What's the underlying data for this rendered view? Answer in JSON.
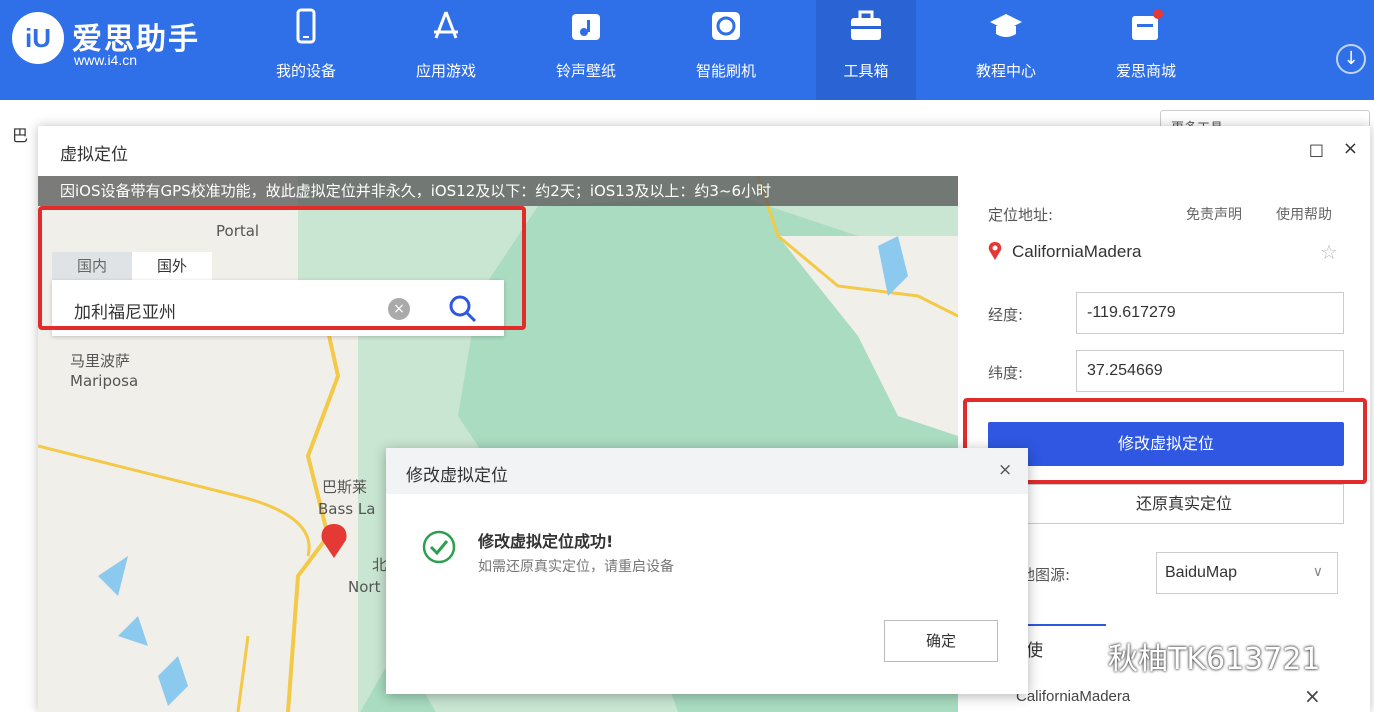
{
  "app": {
    "brand": "爱思助手",
    "url": "www.i4.cn",
    "logo_text": "iU",
    "nav": [
      {
        "label": "我的设备",
        "icon": "phone-icon"
      },
      {
        "label": "应用游戏",
        "icon": "appstore-icon"
      },
      {
        "label": "铃声壁纸",
        "icon": "music-icon"
      },
      {
        "label": "智能刷机",
        "icon": "refresh-icon"
      },
      {
        "label": "工具箱",
        "icon": "toolbox-icon"
      },
      {
        "label": "教程中心",
        "icon": "graduation-cap-icon"
      },
      {
        "label": "爱思商城",
        "icon": "shop-icon"
      }
    ],
    "active_nav": "工具箱",
    "download_icon": "download-icon"
  },
  "background": {
    "left_text": "巴",
    "right_button": "更多工具"
  },
  "window": {
    "title": "虚拟定位",
    "max_symbol": "□",
    "close_symbol": "×"
  },
  "map": {
    "notice": "因iOS设备带有GPS校准功能，故此虚拟定位并非永久，iOS12及以下：约2天；iOS13及以上：约3~6小时",
    "labels": [
      "马里波萨",
      "Mariposa",
      "巴斯莱",
      "Bass La",
      "北",
      "Nort",
      "Portal"
    ],
    "search": {
      "tab_domestic": "国内",
      "tab_foreign": "国外",
      "value": "加利福尼亚州",
      "clear_icon": "clear-icon",
      "search_icon": "search-icon"
    }
  },
  "panel": {
    "address_label": "定位地址:",
    "disclaimer_link": "免责声明",
    "help_link": "使用帮助",
    "location_name": "CaliforniaMadera",
    "longitude_label": "经度:",
    "longitude_value": "-119.617279",
    "latitude_label": "纬度:",
    "latitude_value": "37.254669",
    "modify_button": "修改虚拟定位",
    "restore_button": "还原真实定位",
    "map_source_label": "地图源:",
    "map_source_value": "BaiduMap",
    "history_tab": "使",
    "recent_item": "CaliforniaMadera"
  },
  "dialog": {
    "title": "修改虚拟定位",
    "close_symbol": "×",
    "message": "修改虚拟定位成功!",
    "sub_message": "如需还原真实定位，请重启设备",
    "ok_button": "确定"
  },
  "watermark": {
    "text": "秋柚TK613721"
  },
  "colors": {
    "brand_blue": "#2f6fe8",
    "primary_button": "#2f57e2",
    "highlight_red": "#e22b2b",
    "success_green": "#2e9e4f",
    "pin_red": "#e53935"
  }
}
